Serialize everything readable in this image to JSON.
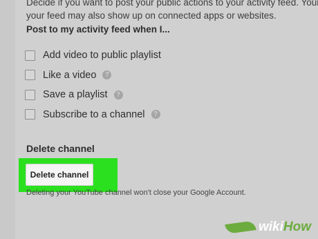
{
  "description": {
    "line1": "Decide if you want to post your public actions to your activity feed. Your a",
    "line2": "your feed may also show up on connected apps or websites."
  },
  "feed_section": {
    "title": "Post to my activity feed when I...",
    "options": [
      {
        "label": "Add video to public playlist",
        "checked": false,
        "has_help": false
      },
      {
        "label": "Like a video",
        "checked": false,
        "has_help": true
      },
      {
        "label": "Save a playlist",
        "checked": false,
        "has_help": true
      },
      {
        "label": "Subscribe to a channel",
        "checked": false,
        "has_help": true
      }
    ],
    "help_glyph": "?"
  },
  "delete_section": {
    "heading": "Delete channel",
    "button_label": "Delete channel",
    "note": "Deleting your YouTube channel won't close your Google Account."
  },
  "watermark": {
    "part1": "wiki",
    "part2": "How"
  },
  "colors": {
    "highlight": "#2be01f",
    "background": "#c9c9c9",
    "watermark_green": "#6cac3f"
  }
}
